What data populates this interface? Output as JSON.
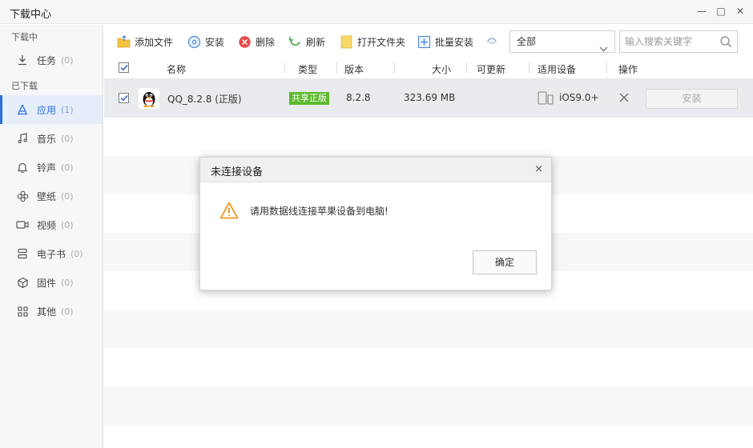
{
  "window": {
    "title": "下载中心",
    "min_glyph": "—",
    "max_glyph": "□",
    "close_glyph": "✕"
  },
  "sidebar": {
    "section_downloading": "下载中",
    "section_downloaded": "已下载",
    "items": [
      {
        "label": "任务",
        "count": "(0)",
        "icon": "download-arrow-icon"
      },
      {
        "label": "应用",
        "count": "(1)",
        "icon": "apps-icon"
      },
      {
        "label": "音乐",
        "count": "(0)",
        "icon": "music-note-icon"
      },
      {
        "label": "铃声",
        "count": "(0)",
        "icon": "bell-icon"
      },
      {
        "label": "壁纸",
        "count": "(0)",
        "icon": "flower-icon"
      },
      {
        "label": "视频",
        "count": "(0)",
        "icon": "video-camera-icon"
      },
      {
        "label": "电子书",
        "count": "(0)",
        "icon": "book-icon"
      },
      {
        "label": "固件",
        "count": "(0)",
        "icon": "cube-icon"
      },
      {
        "label": "其他",
        "count": "(0)",
        "icon": "grid-icon"
      }
    ],
    "accent": "#2f6fde"
  },
  "toolbar": {
    "add_file": "添加文件",
    "install": "安装",
    "delete": "删除",
    "refresh": "刷新",
    "open_folder": "打开文件夹",
    "batch_install": "批量安装",
    "filter_value": "全部",
    "search_placeholder": "输入搜索关键字"
  },
  "table": {
    "headers": {
      "name": "名称",
      "type": "类型",
      "version": "版本",
      "size": "大小",
      "updatable": "可更新",
      "device": "适用设备",
      "action": "操作"
    },
    "rows": [
      {
        "name": "QQ_8.2.8 (正版)",
        "type": "共享正版",
        "version": "8.2.8",
        "size": "323.69 MB",
        "device": "iOS9.0+",
        "install_label": "安装"
      }
    ],
    "badge_color": "#5cb82e"
  },
  "dialog": {
    "title": "未连接设备",
    "close_glyph": "×",
    "message": "请用数据线连接苹果设备到电脑!",
    "ok_label": "确定",
    "warning_color": "#f09a1a"
  }
}
